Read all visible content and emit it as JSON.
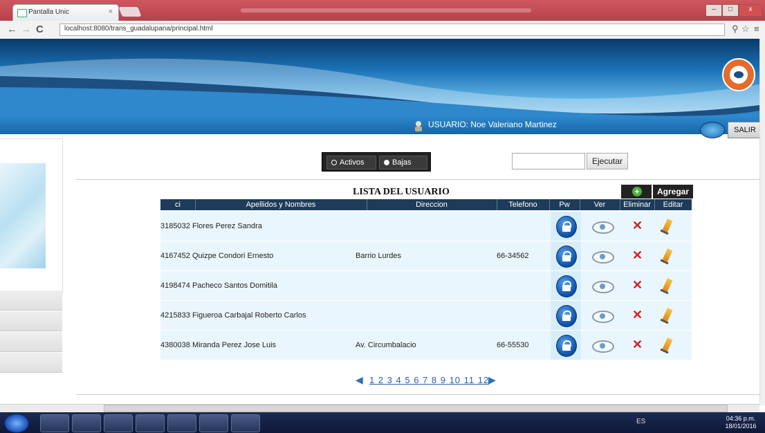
{
  "browser": {
    "tab_title": "Pantalla Unic",
    "tab_close": "×",
    "url": "localhost:8080/trans_guadalupana/principal.html",
    "back_icon": "back-arrow-icon",
    "forward_icon": "forward-arrow-icon",
    "reload_icon": "reload-icon"
  },
  "header": {
    "user_label": "USUARIO:  Noe Valeriano Martinez",
    "salir_label": "SALIR"
  },
  "toolbar": {
    "activos_label": "Activos",
    "bajas_label": "Bajas",
    "ejecutar_label": "Ejecutar",
    "search_value": ""
  },
  "table": {
    "title": "LISTA DEL USUARIO",
    "agregar_label": "Agregar",
    "columns": [
      "ci",
      "Apellidos y Nombres",
      "Direccion",
      "Telefono",
      "Pw",
      "Ver",
      "Eliminar",
      "Editar"
    ],
    "rows": [
      {
        "ci": "3185032",
        "nombre": "Flores Perez Sandra",
        "direccion": "",
        "telefono": ""
      },
      {
        "ci": "4167452",
        "nombre": "Quizpe Condori Ernesto",
        "direccion": "Barrio Lurdes",
        "telefono": "66-34562"
      },
      {
        "ci": "4198474",
        "nombre": "Pacheco Santos Domitila",
        "direccion": "",
        "telefono": ""
      },
      {
        "ci": "4215833",
        "nombre": "Figueroa Carbajal Roberto Carlos",
        "direccion": "",
        "telefono": ""
      },
      {
        "ci": "4380038",
        "nombre": "Miranda Perez Jose Luis",
        "direccion": "Av. Circumbalacio",
        "telefono": "66-55530"
      }
    ]
  },
  "pager": {
    "pages": "1 2 3 4 5 6 7 8 9 10 11 12"
  },
  "taskbar": {
    "tray_lang": "ES",
    "time": "04:36 p.m.",
    "date": "18/01/2016"
  }
}
